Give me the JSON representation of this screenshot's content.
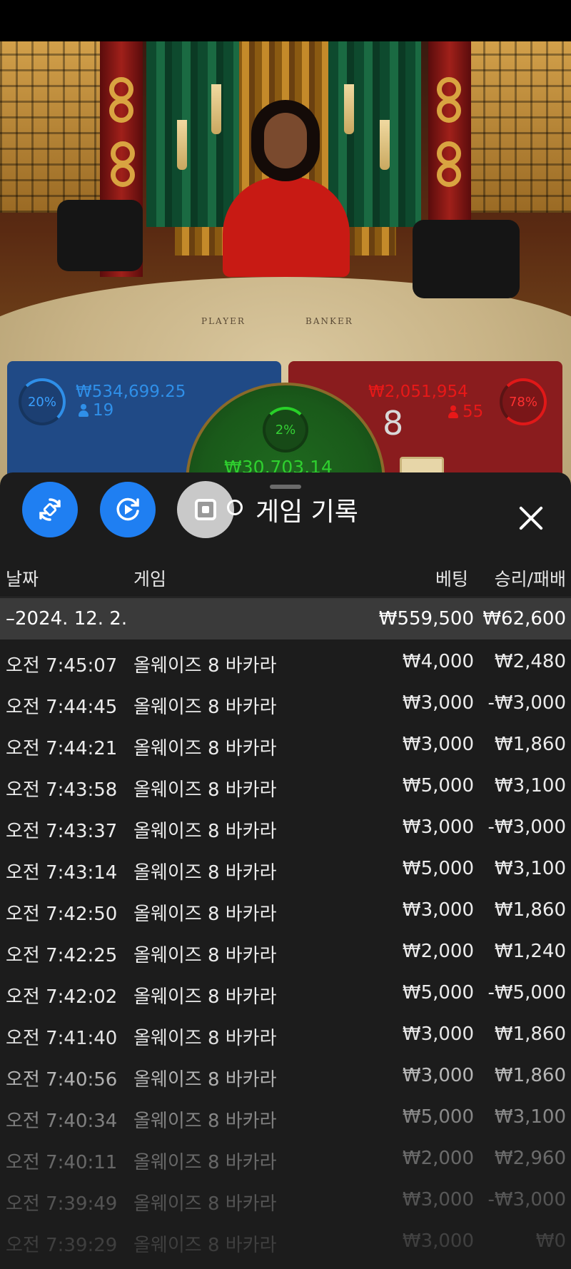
{
  "video": {
    "table_labels": [
      "PLAYER",
      "BANKER"
    ]
  },
  "player_bet": {
    "percent": "20%",
    "amount": "₩534,699.25",
    "players": "19",
    "color": "#2f8fe8"
  },
  "banker_bet": {
    "percent": "78%",
    "amount": "₩2,051,954",
    "players": "55",
    "score": "8",
    "color": "#ff2020"
  },
  "tie_bet": {
    "percent": "2%",
    "amount": "₩30,703.14",
    "color": "#2fd02f"
  },
  "sheet": {
    "title": "게임 기록",
    "buttons": [
      "rotate-icon",
      "replay-icon",
      "stop-icon"
    ],
    "columns": {
      "date": "날짜",
      "game": "게임",
      "bet": "베팅",
      "win_loss": "승리/패배"
    },
    "date_group": {
      "date": "–2024. 12. 2.",
      "bet_total": "₩559,500",
      "win_total": "₩62,600"
    },
    "rows": [
      {
        "time": "오전 7:45:07",
        "game": "올웨이즈 8 바카라",
        "bet": "₩4,000",
        "result": "₩2,480"
      },
      {
        "time": "오전 7:44:45",
        "game": "올웨이즈 8 바카라",
        "bet": "₩3,000",
        "result": "-₩3,000"
      },
      {
        "time": "오전 7:44:21",
        "game": "올웨이즈 8 바카라",
        "bet": "₩3,000",
        "result": "₩1,860"
      },
      {
        "time": "오전 7:43:58",
        "game": "올웨이즈 8 바카라",
        "bet": "₩5,000",
        "result": "₩3,100"
      },
      {
        "time": "오전 7:43:37",
        "game": "올웨이즈 8 바카라",
        "bet": "₩3,000",
        "result": "-₩3,000"
      },
      {
        "time": "오전 7:43:14",
        "game": "올웨이즈 8 바카라",
        "bet": "₩5,000",
        "result": "₩3,100"
      },
      {
        "time": "오전 7:42:50",
        "game": "올웨이즈 8 바카라",
        "bet": "₩3,000",
        "result": "₩1,860"
      },
      {
        "time": "오전 7:42:25",
        "game": "올웨이즈 8 바카라",
        "bet": "₩2,000",
        "result": "₩1,240"
      },
      {
        "time": "오전 7:42:02",
        "game": "올웨이즈 8 바카라",
        "bet": "₩5,000",
        "result": "-₩5,000"
      },
      {
        "time": "오전 7:41:40",
        "game": "올웨이즈 8 바카라",
        "bet": "₩3,000",
        "result": "₩1,860"
      },
      {
        "time": "오전 7:40:56",
        "game": "올웨이즈 8 바카라",
        "bet": "₩3,000",
        "result": "₩1,860"
      },
      {
        "time": "오전 7:40:34",
        "game": "올웨이즈 8 바카라",
        "bet": "₩5,000",
        "result": "₩3,100"
      },
      {
        "time": "오전 7:40:11",
        "game": "올웨이즈 8 바카라",
        "bet": "₩2,000",
        "result": "₩2,960"
      },
      {
        "time": "오전 7:39:49",
        "game": "올웨이즈 8 바카라",
        "bet": "₩3,000",
        "result": "-₩3,000"
      },
      {
        "time": "오전 7:39:29",
        "game": "올웨이즈 8 바카라",
        "bet": "₩3,000",
        "result": "₩0"
      }
    ]
  }
}
